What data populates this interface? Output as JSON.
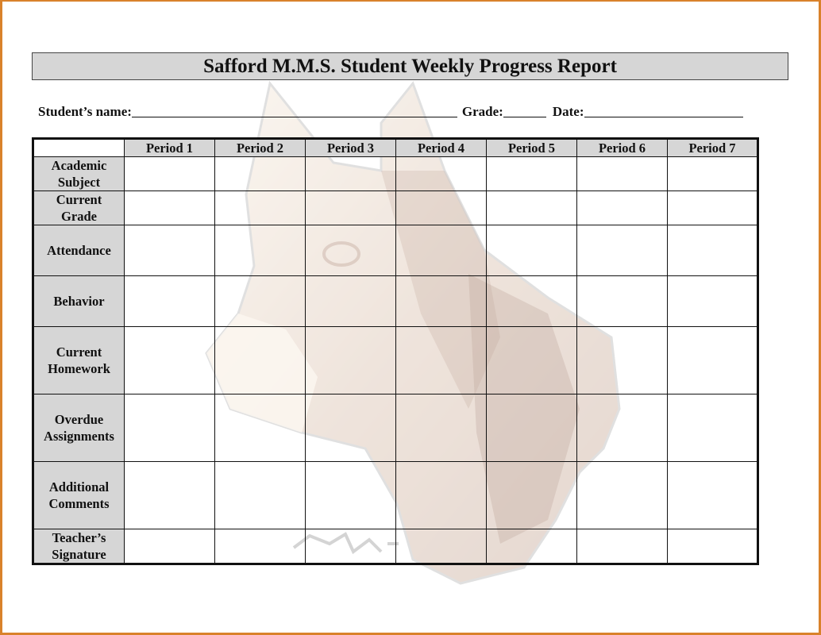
{
  "document": {
    "title": "Safford M.M.S. Student Weekly Progress Report",
    "fields": {
      "student_name_label": "Student’s name:",
      "grade_label": "Grade:",
      "date_label": "Date:",
      "student_name_value": "",
      "grade_value": "",
      "date_value": ""
    },
    "table": {
      "corner_label": "",
      "columns": [
        "Period 1",
        "Period 2",
        "Period 3",
        "Period 4",
        "Period 5",
        "Period 6",
        "Period 7"
      ],
      "rows": [
        {
          "label_line1": "Academic",
          "label_line2": "Subject",
          "values": [
            "",
            "",
            "",
            "",
            "",
            "",
            ""
          ]
        },
        {
          "label_line1": "Current",
          "label_line2": "Grade",
          "values": [
            "",
            "",
            "",
            "",
            "",
            "",
            ""
          ]
        },
        {
          "label_line1": "Attendance",
          "label_line2": "",
          "values": [
            "",
            "",
            "",
            "",
            "",
            "",
            ""
          ]
        },
        {
          "label_line1": "Behavior",
          "label_line2": "",
          "values": [
            "",
            "",
            "",
            "",
            "",
            "",
            ""
          ]
        },
        {
          "label_line1": "Current",
          "label_line2": "Homework",
          "values": [
            "",
            "",
            "",
            "",
            "",
            "",
            ""
          ]
        },
        {
          "label_line1": "Overdue",
          "label_line2": "Assignments",
          "values": [
            "",
            "",
            "",
            "",
            "",
            "",
            ""
          ]
        },
        {
          "label_line1": "Additional",
          "label_line2": "Comments",
          "values": [
            "",
            "",
            "",
            "",
            "",
            "",
            ""
          ]
        },
        {
          "label_line1": "Teacher’s",
          "label_line2": "Signature",
          "values": [
            "",
            "",
            "",
            "",
            "",
            "",
            ""
          ]
        }
      ]
    },
    "watermark": {
      "icon": "husky-dog-head-watermark"
    },
    "colors": {
      "frame": "#d9822b",
      "header_fill": "#d6d6d6",
      "text": "#111111"
    }
  }
}
